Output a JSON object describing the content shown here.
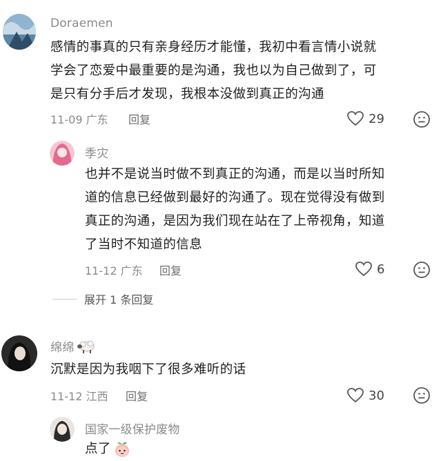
{
  "comments": [
    {
      "username": "Doraemen",
      "text": "感情的事真的只有亲身经历才能懂，我初中看言情小说就学会了恋爱中最重要的是沟通，我也以为自己做到了，可是只有分手后才发现，我根本没做到真正的沟通",
      "lines": [
        "感情的事真的只有亲身经历才能懂，我初中看言情小说就",
        "学会了恋爱中最重要的是沟通，我也以为自己做到了，可",
        "是只有分手后才发现，我根本没做到真正的沟通"
      ],
      "date": "11-09",
      "location": "广东",
      "reply_label": "回复",
      "likes": "29"
    },
    {
      "username": "季灾",
      "lines": [
        "也并不是说当时做不到真正的沟通，而是以当时所知",
        "道的信息已经做到最好的沟通了。现在觉得没有做到",
        "真正的沟通，是因为我们现在站在了上帝视角，知道",
        "了当时不知道的信息"
      ],
      "date": "11-12",
      "location": "广东",
      "reply_label": "回复",
      "likes": "6"
    },
    {
      "expand_label": "展开 1 条回复"
    },
    {
      "username": "绵绵",
      "username_emoji": "sheep-icon",
      "text": "沉默是因为我咽下了很多难听的话",
      "date": "11-12",
      "location": "江西",
      "reply_label": "回复",
      "likes": "30"
    },
    {
      "username": "国家一级保护废物",
      "text": "点了",
      "text_emoji": "peach-icon"
    }
  ],
  "colors": {
    "secondary_text": "#8a8a8a",
    "primary_text": "#1f1f1f"
  }
}
